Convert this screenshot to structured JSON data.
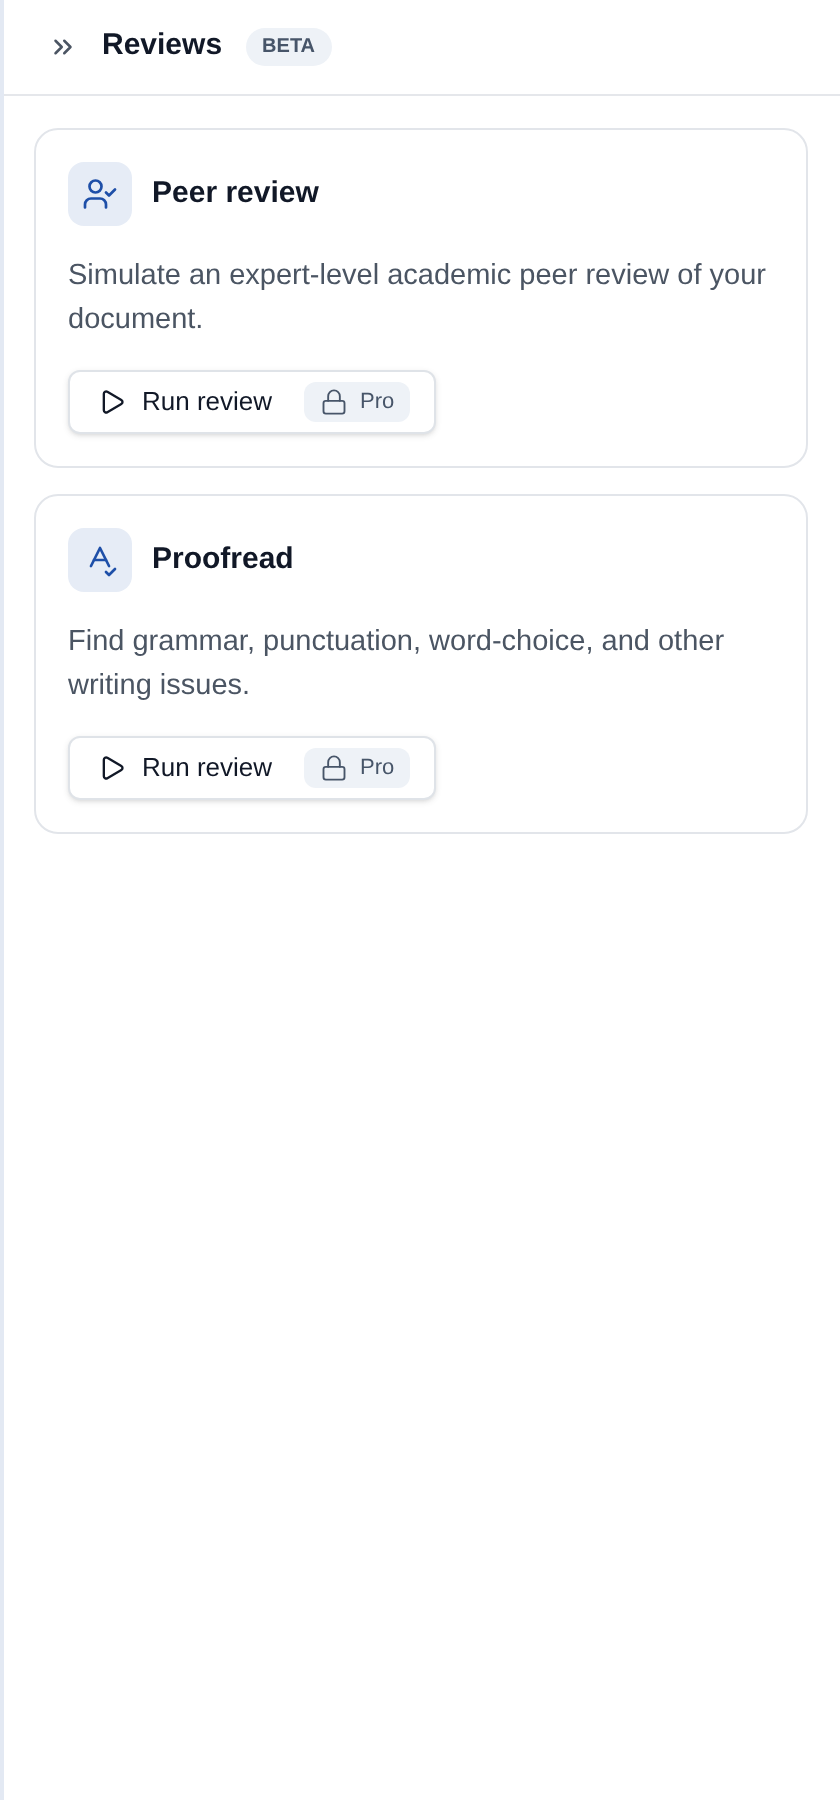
{
  "header": {
    "title": "Reviews",
    "badge": "BETA"
  },
  "cards": [
    {
      "kind": "peer",
      "title": "Peer review",
      "description": "Simulate an expert-level academic peer review of your document.",
      "button": "Run review",
      "tag": "Pro"
    },
    {
      "kind": "proofread",
      "title": "Proofread",
      "description": "Find grammar, punctuation, word-choice, and other writing issues.",
      "button": "Run review",
      "tag": "Pro"
    }
  ]
}
